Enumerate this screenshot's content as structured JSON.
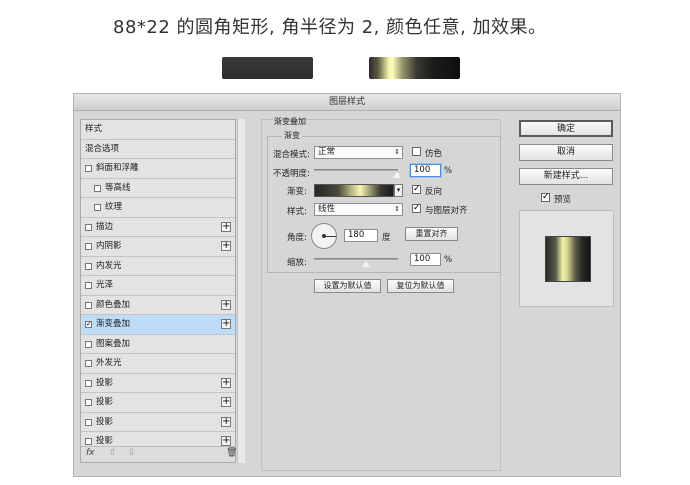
{
  "heading": "88*22 的圆角矩形, 角半径为 2, 颜色任意, 加效果。",
  "dialog": {
    "title": "图层样式",
    "styles_list": [
      {
        "label": "样式",
        "checkbox": false,
        "checked": false,
        "plus": false,
        "selected": false,
        "indent": false
      },
      {
        "label": "混合选项",
        "checkbox": false,
        "checked": false,
        "plus": false,
        "selected": false,
        "indent": false
      },
      {
        "label": "斜面和浮雕",
        "checkbox": true,
        "checked": false,
        "plus": false,
        "selected": false,
        "indent": false
      },
      {
        "label": "等高线",
        "checkbox": true,
        "checked": false,
        "plus": false,
        "selected": false,
        "indent": true
      },
      {
        "label": "纹理",
        "checkbox": true,
        "checked": false,
        "plus": false,
        "selected": false,
        "indent": true
      },
      {
        "label": "描边",
        "checkbox": true,
        "checked": false,
        "plus": true,
        "selected": false,
        "indent": false
      },
      {
        "label": "内阴影",
        "checkbox": true,
        "checked": false,
        "plus": true,
        "selected": false,
        "indent": false
      },
      {
        "label": "内发光",
        "checkbox": true,
        "checked": false,
        "plus": false,
        "selected": false,
        "indent": false
      },
      {
        "label": "光泽",
        "checkbox": true,
        "checked": false,
        "plus": false,
        "selected": false,
        "indent": false
      },
      {
        "label": "颜色叠加",
        "checkbox": true,
        "checked": false,
        "plus": true,
        "selected": false,
        "indent": false
      },
      {
        "label": "渐变叠加",
        "checkbox": true,
        "checked": true,
        "plus": true,
        "selected": true,
        "indent": false
      },
      {
        "label": "图案叠加",
        "checkbox": true,
        "checked": false,
        "plus": false,
        "selected": false,
        "indent": false
      },
      {
        "label": "外发光",
        "checkbox": true,
        "checked": false,
        "plus": false,
        "selected": false,
        "indent": false
      },
      {
        "label": "投影",
        "checkbox": true,
        "checked": false,
        "plus": true,
        "selected": false,
        "indent": false
      },
      {
        "label": "投影",
        "checkbox": true,
        "checked": false,
        "plus": true,
        "selected": false,
        "indent": false
      },
      {
        "label": "投影",
        "checkbox": true,
        "checked": false,
        "plus": true,
        "selected": false,
        "indent": false
      },
      {
        "label": "投影",
        "checkbox": true,
        "checked": false,
        "plus": true,
        "selected": false,
        "indent": false
      }
    ],
    "list_footer": {
      "fx_label": "fx",
      "up_icon": "arrow-up-icon",
      "down_icon": "arrow-down-icon",
      "trash_icon": "trash-icon"
    },
    "gradient_overlay": {
      "section_title": "渐变叠加",
      "group_title": "渐变",
      "blend_mode_label": "混合模式:",
      "blend_mode_value": "正常",
      "dither_label": "仿色",
      "dither_checked": false,
      "opacity_label": "不透明度:",
      "opacity_value": "100",
      "opacity_unit": "%",
      "gradient_label": "渐变:",
      "reverse_label": "反向",
      "reverse_checked": true,
      "style_label": "样式:",
      "style_value": "线性",
      "align_label": "与图层对齐",
      "align_checked": true,
      "angle_label": "角度:",
      "angle_value": "180",
      "angle_unit": "度",
      "reset_alignment_button": "重置对齐",
      "scale_label": "缩放:",
      "scale_value": "100",
      "scale_unit": "%",
      "set_default_button": "设置为默认值",
      "reset_default_button": "复位为默认值"
    },
    "right_buttons": {
      "ok": "确定",
      "cancel": "取消",
      "new_style": "新建样式...",
      "preview_label": "预览",
      "preview_checked": true
    }
  }
}
